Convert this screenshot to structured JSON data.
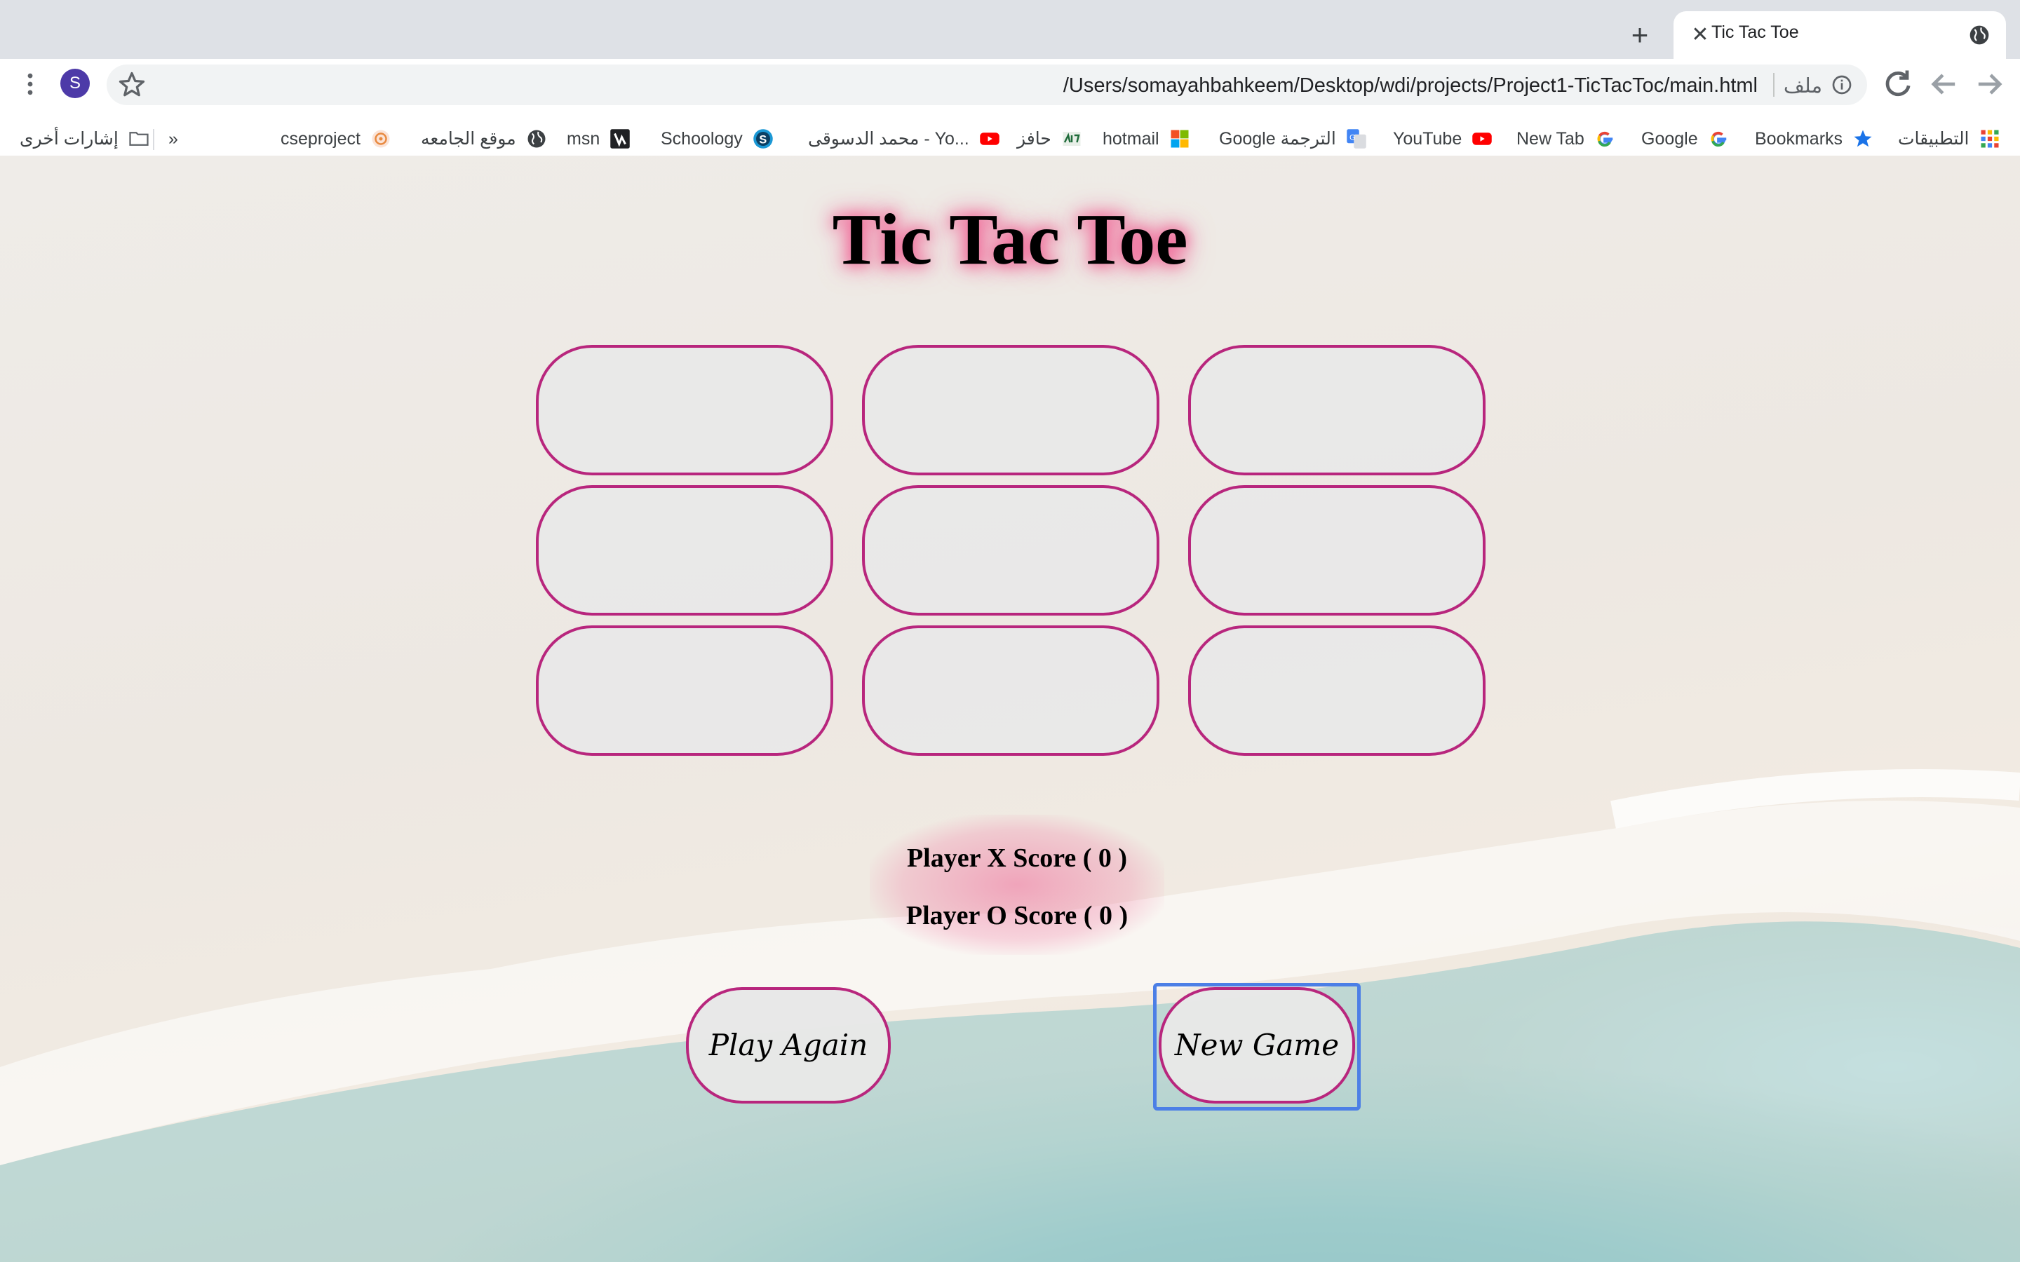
{
  "tab": {
    "title": "Tic Tac Toe"
  },
  "address_bar": {
    "url": "/Users/somayahbahkeem/Desktop/wdi/projects/Project1-TicTacToc/main.html",
    "scheme_label": "ملف"
  },
  "profile": {
    "initial": "S"
  },
  "bookmarks": {
    "apps": "التطبيقات",
    "items": [
      "Bookmarks",
      "Google",
      "New Tab",
      "YouTube",
      "Google الترجمة",
      "hotmail",
      "حافز",
      "محمد الدسوقى - Yo...",
      "Schoology",
      "msn",
      "موقع الجامعه",
      "cseproject"
    ],
    "overflow": "»",
    "other": "إشارات أخرى"
  },
  "game": {
    "title": "Tic Tac Toe",
    "cells": [
      "",
      "",
      "",
      "",
      "",
      "",
      "",
      "",
      ""
    ],
    "score_x": "Player X Score ( 0 )",
    "score_o": "Player O Score ( 0 )",
    "play_again": "Play Again",
    "new_game": "New Game"
  },
  "colors": {
    "cell_border": "#b8267d",
    "glow": "#f06b9a",
    "focus_ring": "#4c7fe6"
  }
}
